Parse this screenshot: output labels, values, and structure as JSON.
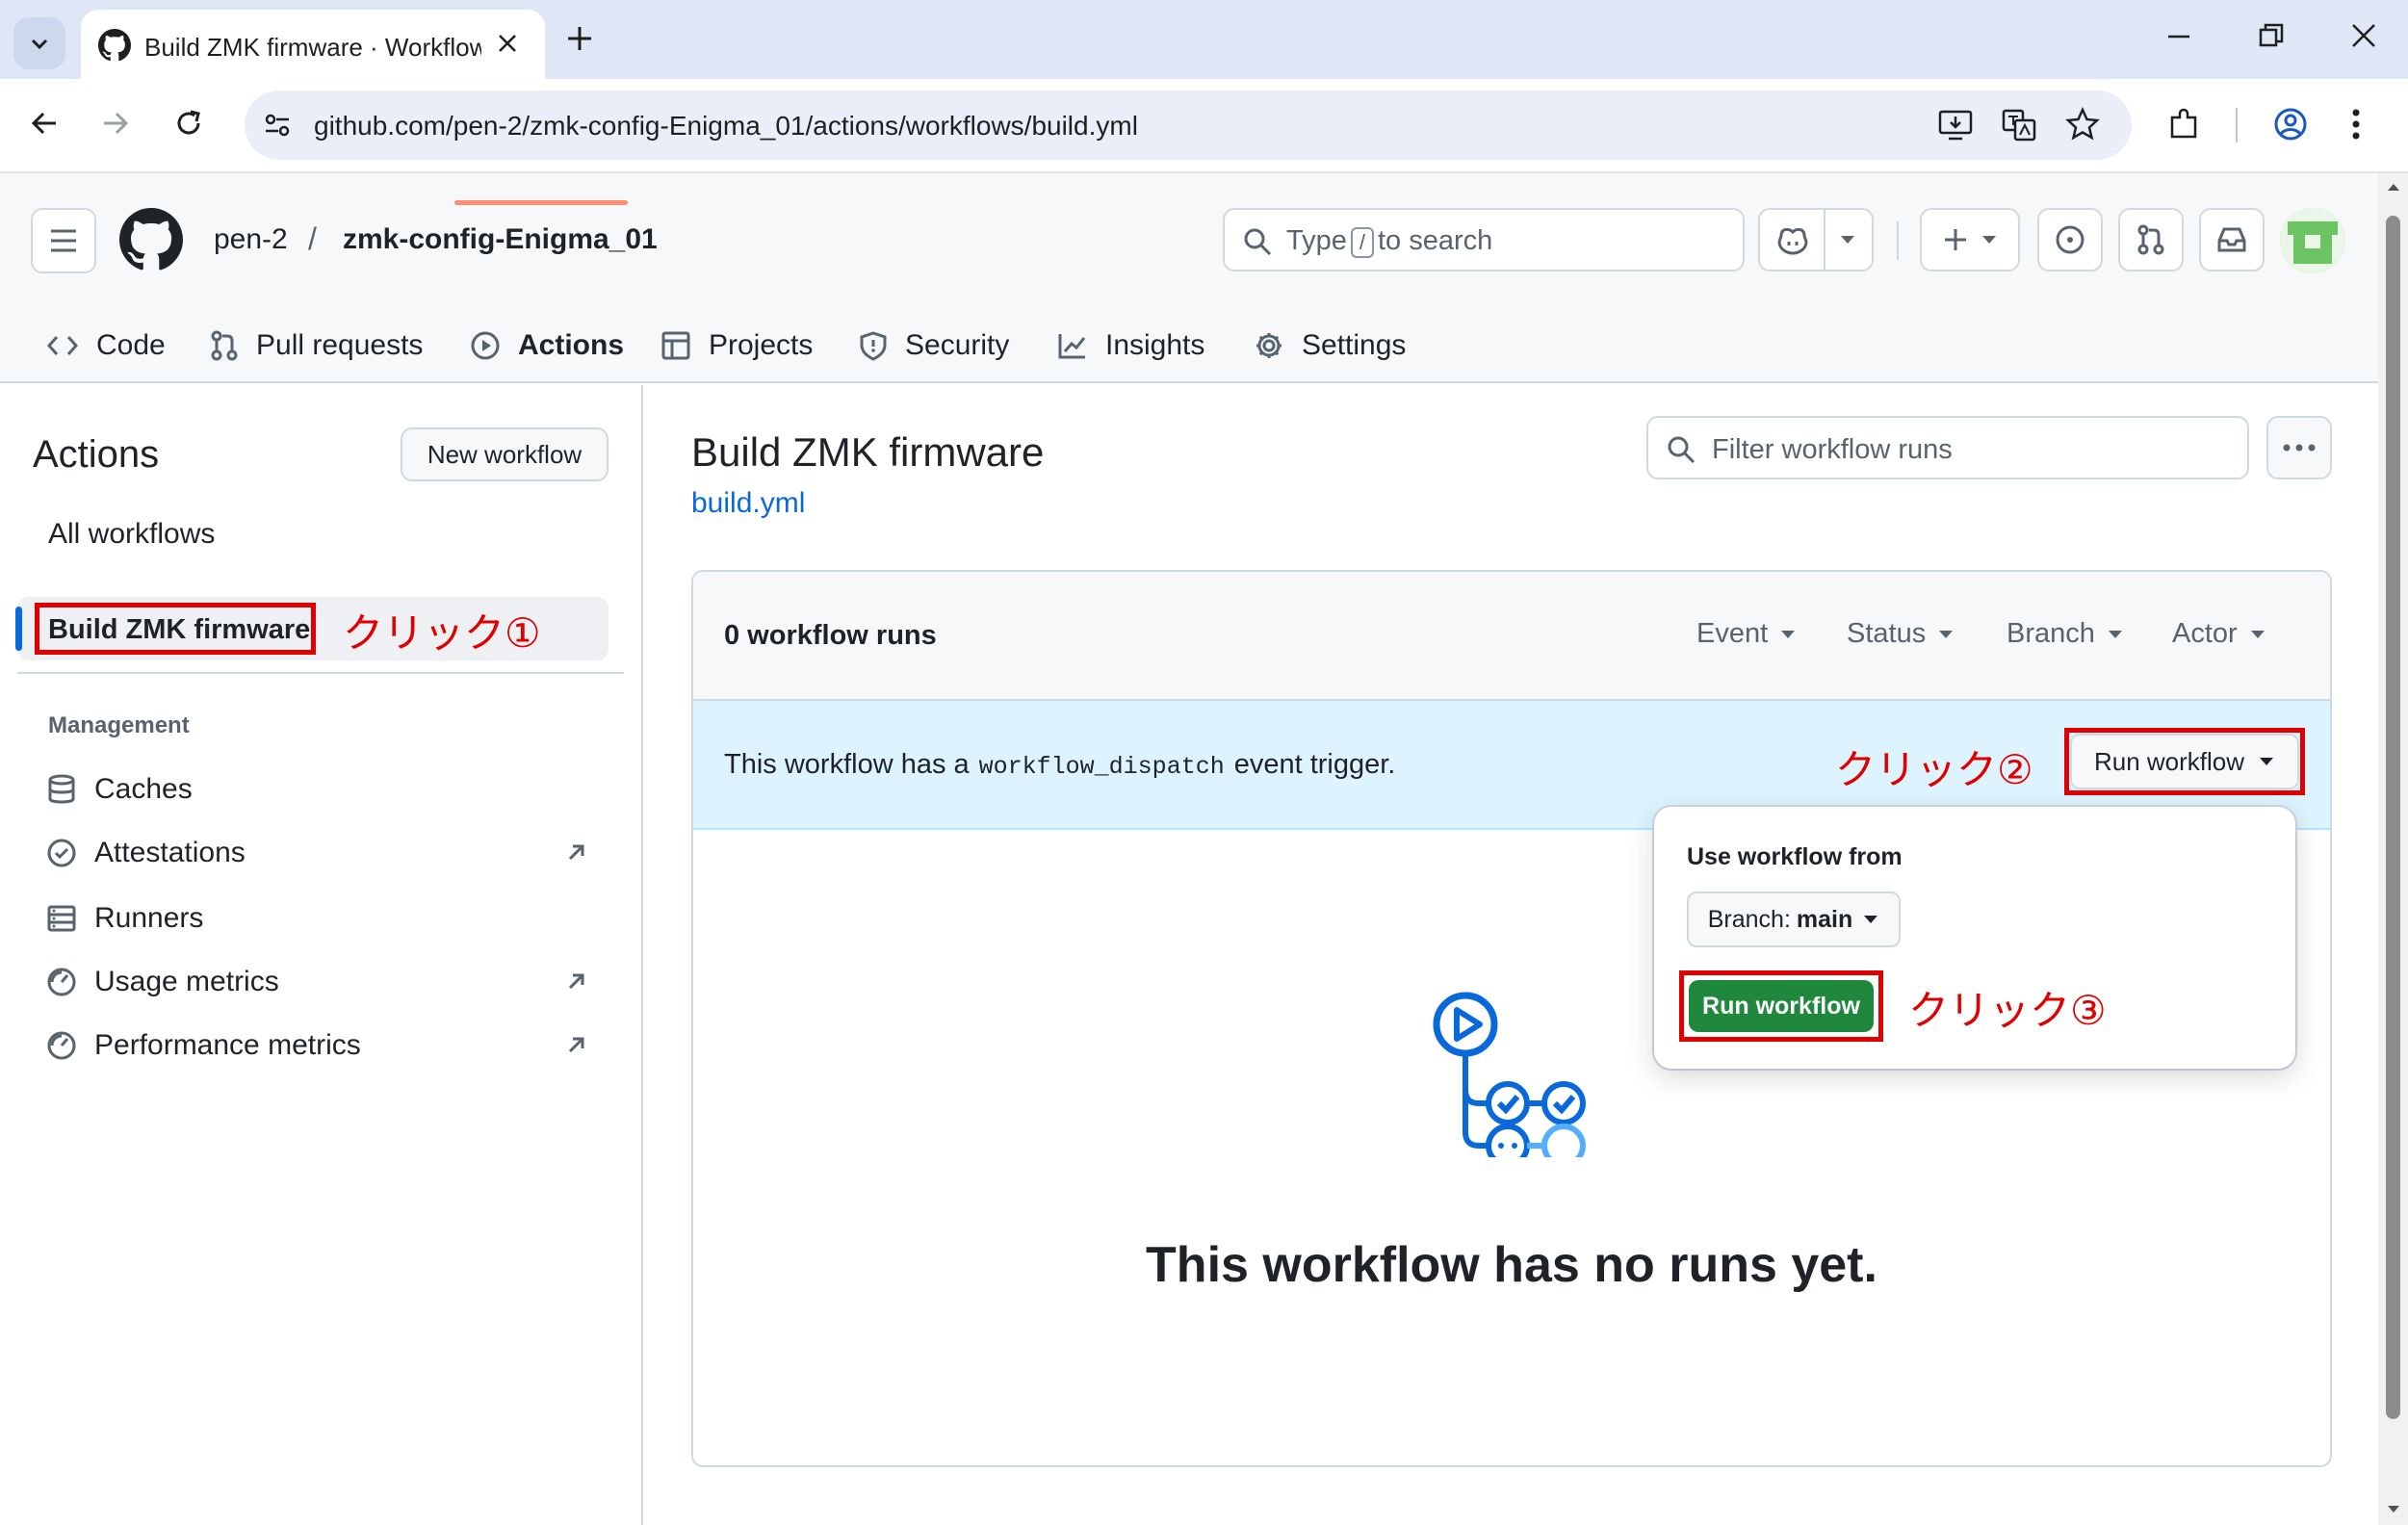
{
  "browser": {
    "tab_title": "Build ZMK firmware · Workflow",
    "url": "github.com/pen-2/zmk-config-Enigma_01/actions/workflows/build.yml"
  },
  "header": {
    "owner": "pen-2",
    "separator": "/",
    "repo": "zmk-config-Enigma_01",
    "search_prefix": "Type",
    "search_key": "/",
    "search_suffix": "to search"
  },
  "repo_nav": [
    {
      "label": "Code",
      "icon": "code-icon"
    },
    {
      "label": "Pull requests",
      "icon": "pull-request-icon"
    },
    {
      "label": "Actions",
      "icon": "play-icon"
    },
    {
      "label": "Projects",
      "icon": "table-icon"
    },
    {
      "label": "Security",
      "icon": "shield-icon"
    },
    {
      "label": "Insights",
      "icon": "graph-icon"
    },
    {
      "label": "Settings",
      "icon": "gear-icon"
    }
  ],
  "sidebar": {
    "title": "Actions",
    "new_workflow": "New workflow",
    "all_workflows": "All workflows",
    "selected_workflow": "Build ZMK firmware",
    "management_heading": "Management",
    "management_items": [
      {
        "label": "Caches",
        "icon": "database-icon"
      },
      {
        "label": "Attestations",
        "icon": "verified-icon"
      },
      {
        "label": "Runners",
        "icon": "server-icon"
      },
      {
        "label": "Usage metrics",
        "icon": "meter-icon"
      },
      {
        "label": "Performance metrics",
        "icon": "meter-icon"
      }
    ]
  },
  "main": {
    "title": "Build ZMK firmware",
    "file": "build.yml",
    "filter_placeholder": "Filter workflow runs",
    "runs_count": "0 workflow runs",
    "filters": [
      "Event",
      "Status",
      "Branch",
      "Actor"
    ],
    "dispatch_prefix": "This workflow has a",
    "dispatch_code": "workflow_dispatch",
    "dispatch_suffix": "event trigger.",
    "run_workflow_button": "Run workflow",
    "empty_message": "This workflow has no runs yet."
  },
  "popover": {
    "title": "Use workflow from",
    "branch_label": "Branch:",
    "branch_value": "main",
    "run_button": "Run workflow"
  },
  "annotations": {
    "click1": "クリック①",
    "click2": "クリック②",
    "click3": "クリック③"
  },
  "colors": {
    "accent_blue": "#0969da",
    "green_button": "#1f883d",
    "highlight_red": "#e00000",
    "nav_underline": "#fd8c73"
  }
}
